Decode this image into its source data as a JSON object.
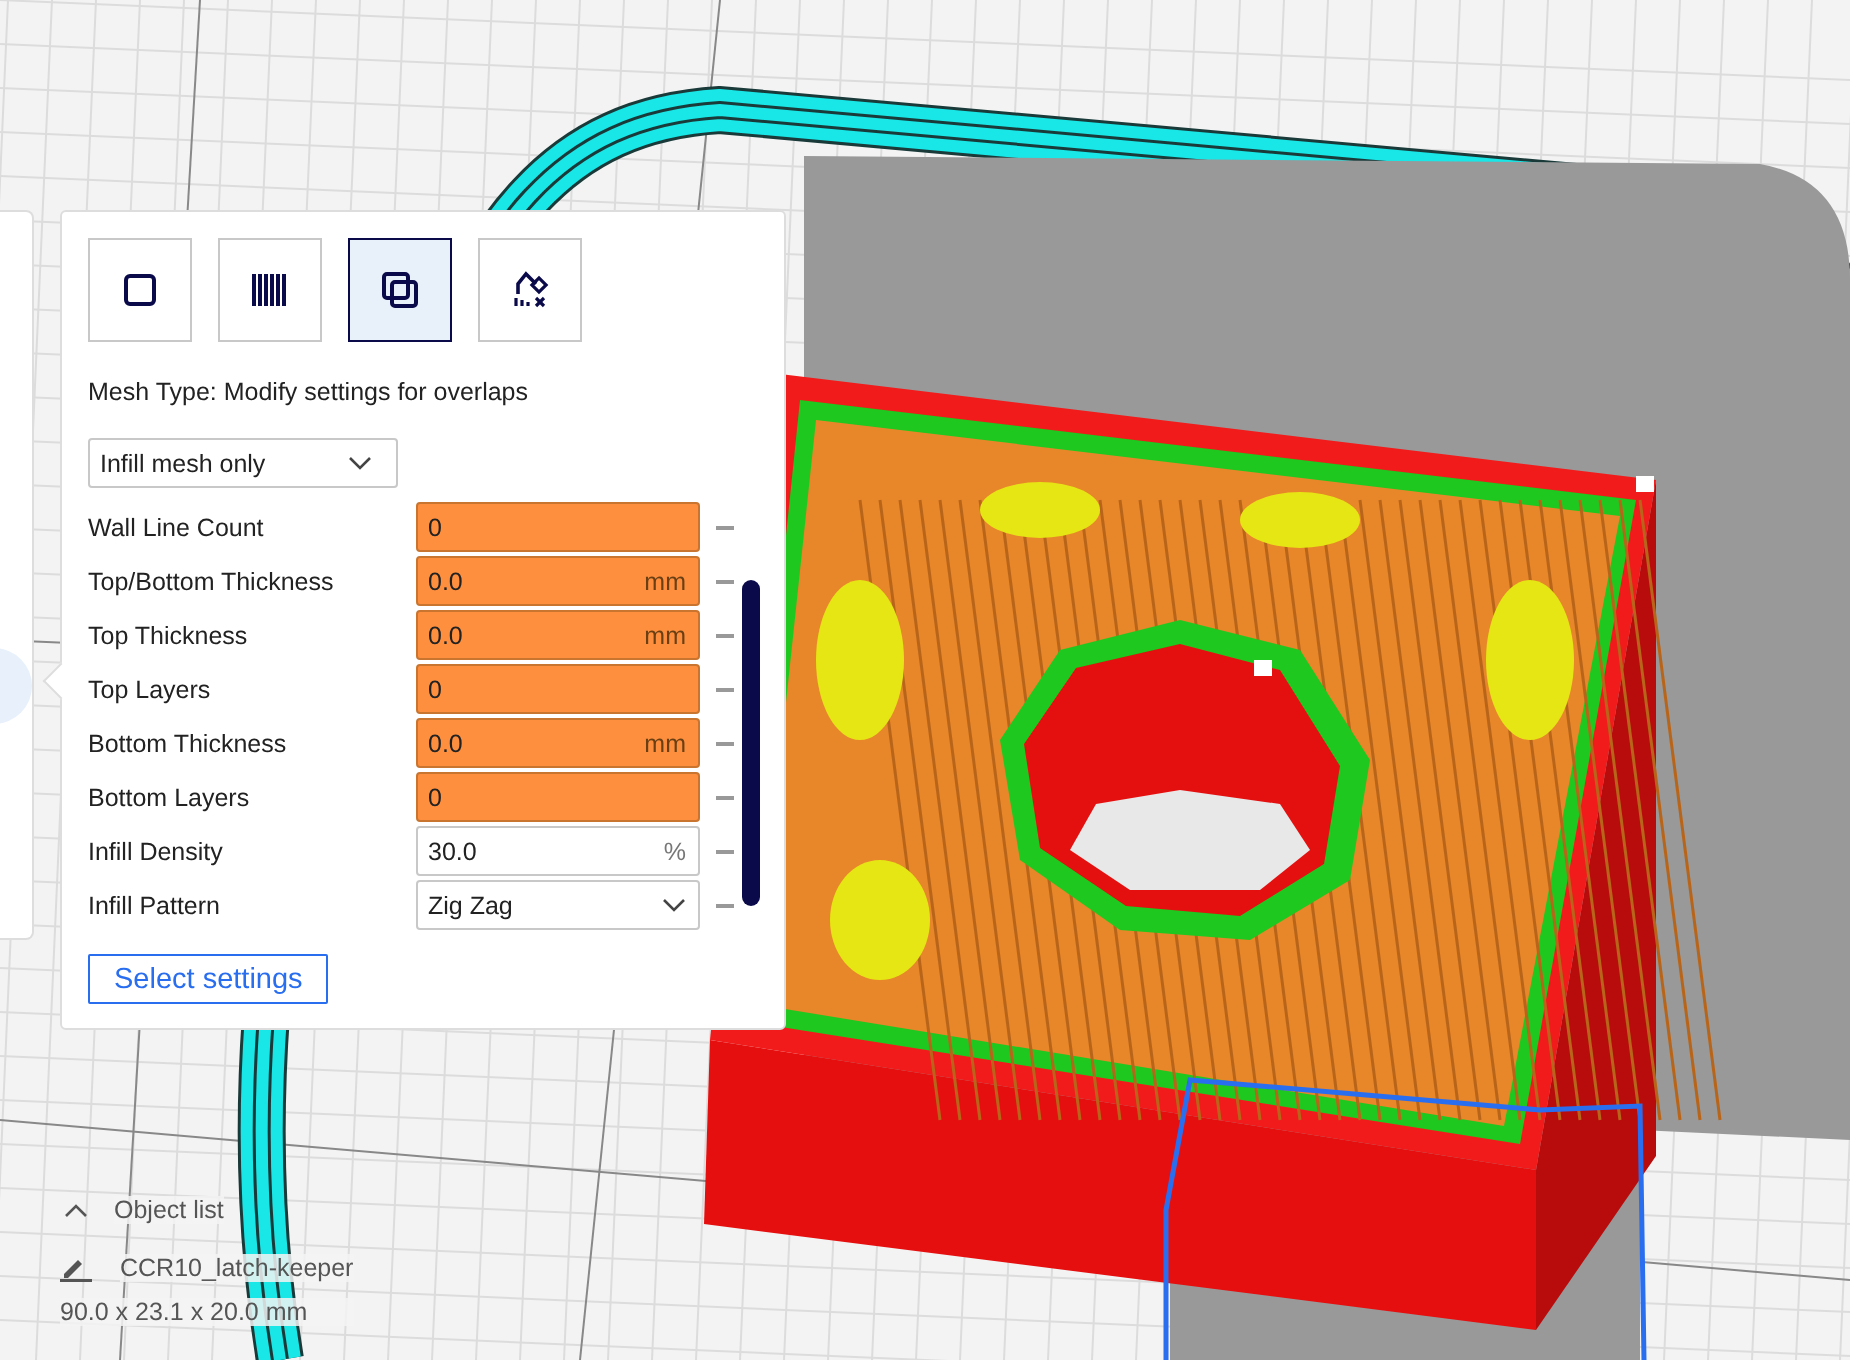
{
  "mesh_types": [
    {
      "kind": "normal",
      "selected": false
    },
    {
      "kind": "support",
      "selected": false
    },
    {
      "kind": "overlap",
      "selected": true
    },
    {
      "kind": "blocker",
      "selected": false
    }
  ],
  "mesh_type_label": "Mesh Type: Modify settings for overlaps",
  "mode_dropdown": {
    "value": "Infill mesh only"
  },
  "settings": [
    {
      "label": "Wall Line Count",
      "kind": "number",
      "value": "0",
      "overridden": true
    },
    {
      "label": "Top/Bottom Thickness",
      "kind": "number",
      "value": "0.0",
      "unit": "mm",
      "overridden": true
    },
    {
      "label": "Top Thickness",
      "kind": "number",
      "value": "0.0",
      "unit": "mm",
      "overridden": true
    },
    {
      "label": "Top Layers",
      "kind": "number",
      "value": "0",
      "overridden": true
    },
    {
      "label": "Bottom Thickness",
      "kind": "number",
      "value": "0.0",
      "unit": "mm",
      "overridden": true
    },
    {
      "label": "Bottom Layers",
      "kind": "number",
      "value": "0",
      "overridden": true
    },
    {
      "label": "Infill Density",
      "kind": "number",
      "value": "30.0",
      "unit": "%",
      "overridden": false
    },
    {
      "label": "Infill Pattern",
      "kind": "dropdown",
      "value": "Zig Zag",
      "overridden": false
    }
  ],
  "select_settings_button": "Select settings",
  "object_list": {
    "toggle": "Object list",
    "object_name": "CCR10_latch-keeper",
    "dimensions": "90.0 x 23.1 x 20.0 mm"
  }
}
